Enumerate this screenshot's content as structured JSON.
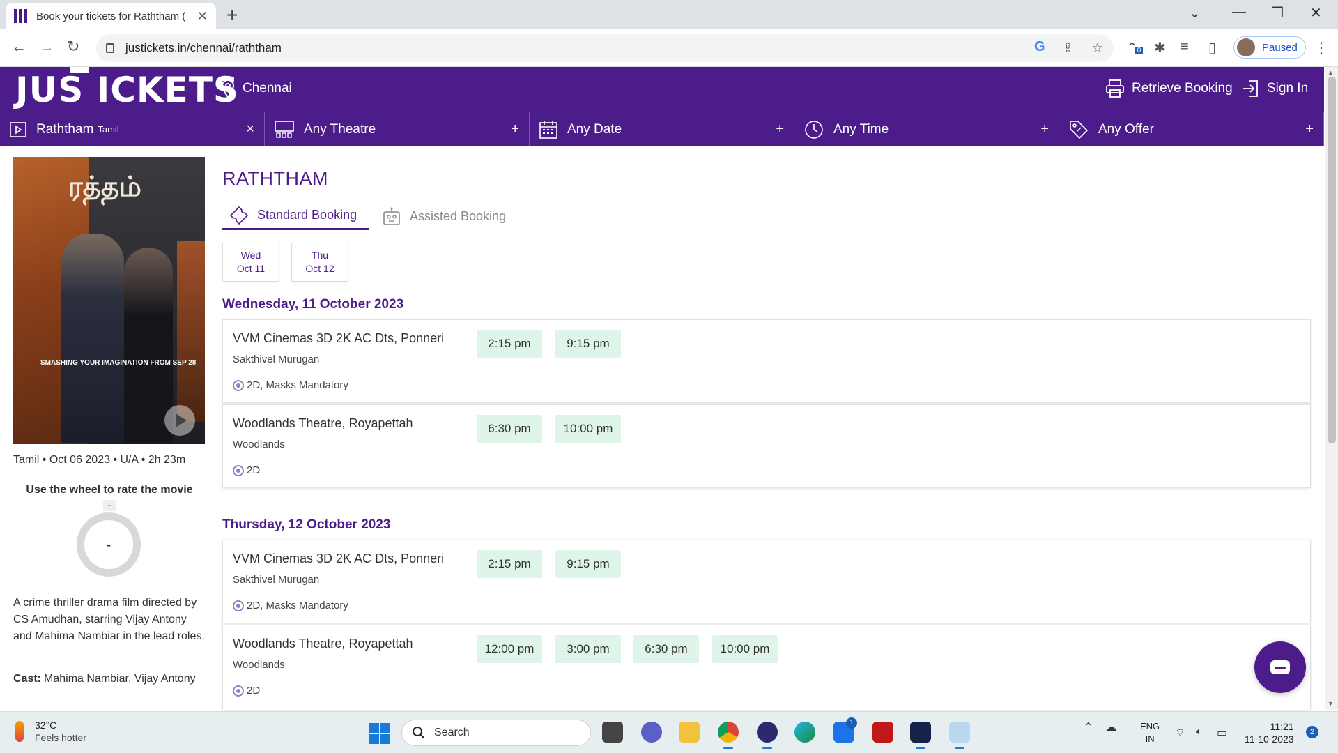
{
  "browser": {
    "tab_title": "Book your tickets for Raththam (",
    "url": "justickets.in/chennai/raththam",
    "profile_status": "Paused",
    "extension_badge": "0"
  },
  "header": {
    "logo_text": "JUS ICKETS",
    "city": "Chennai",
    "retrieve_label": "Retrieve Booking",
    "signin_label": "Sign In"
  },
  "filters": [
    {
      "label": "Raththam",
      "sub": "Tamil",
      "action": "×"
    },
    {
      "label": "Any Theatre",
      "sub": "",
      "action": "+"
    },
    {
      "label": "Any Date",
      "sub": "",
      "action": "+"
    },
    {
      "label": "Any Time",
      "sub": "",
      "action": "+"
    },
    {
      "label": "Any Offer",
      "sub": "",
      "action": "+"
    }
  ],
  "movie": {
    "title": "RATHTHAM",
    "poster_title": "ரத்தம்",
    "poster_tagline": "SMASHING YOUR IMAGINATION FROM SEP 28",
    "meta": "Tamil • Oct 06 2023 • U/A • 2h 23m",
    "rate_label": "Use the wheel to rate the movie",
    "rate_value": "-",
    "rate_marker": "-",
    "synopsis": "A crime thriller drama film directed by CS Amudhan, starring Vijay Antony and Mahima Nambiar in the lead roles.",
    "cast_label": "Cast:",
    "cast": "Mahima Nambiar, Vijay Antony"
  },
  "booking_tabs": {
    "standard": "Standard Booking",
    "assisted": "Assisted Booking"
  },
  "date_chips": [
    {
      "day": "Wed",
      "date": "Oct 11"
    },
    {
      "day": "Thu",
      "date": "Oct 12"
    }
  ],
  "days": [
    {
      "heading": "Wednesday, 11 October 2023",
      "theatres": [
        {
          "name": "VVM Cinemas 3D 2K AC Dts, Ponneri",
          "sub": "Sakthivel Murugan",
          "tags": "2D, Masks Mandatory",
          "times": [
            "2:15 pm",
            "9:15 pm"
          ]
        },
        {
          "name": "Woodlands Theatre, Royapettah",
          "sub": "Woodlands",
          "tags": "2D",
          "times": [
            "6:30 pm",
            "10:00 pm"
          ]
        }
      ]
    },
    {
      "heading": "Thursday, 12 October 2023",
      "theatres": [
        {
          "name": "VVM Cinemas 3D 2K AC Dts, Ponneri",
          "sub": "Sakthivel Murugan",
          "tags": "2D, Masks Mandatory",
          "times": [
            "2:15 pm",
            "9:15 pm"
          ]
        },
        {
          "name": "Woodlands Theatre, Royapettah",
          "sub": "Woodlands",
          "tags": "2D",
          "times": [
            "12:00 pm",
            "3:00 pm",
            "6:30 pm",
            "10:00 pm"
          ]
        }
      ]
    }
  ],
  "taskbar": {
    "temperature": "32°C",
    "weather_desc": "Feels hotter",
    "search_placeholder": "Search",
    "lang_top": "ENG",
    "lang_bottom": "IN",
    "time": "11:21",
    "date": "11-10-2023",
    "notification_count": "2",
    "store_badge": "1"
  },
  "colors": {
    "brand_purple": "#4c1d8a",
    "showtime_bg": "#dff5ea"
  }
}
